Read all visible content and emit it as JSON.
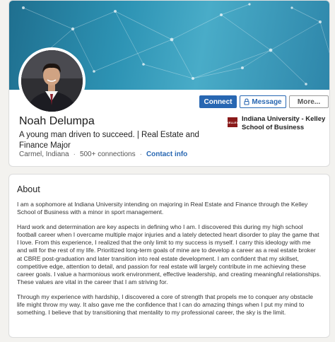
{
  "profile": {
    "name": "Noah Delumpa",
    "headline": "A young man driven to succeed. | Real Estate and Finance Major",
    "location": "Carmel, Indiana",
    "connections": "500+ connections",
    "contact_info": "Contact info",
    "education": {
      "logo_text": "KELLEY",
      "name": "Indiana University - Kelley School of Business"
    },
    "actions": {
      "connect": "Connect",
      "message": "Message",
      "more": "More..."
    }
  },
  "about": {
    "title": "About",
    "paragraphs": [
      "I am a sophomore at Indiana University intending on majoring in Real Estate and Finance through the Kelley School of Business with a minor in sport management.",
      "Hard work and determination are key aspects in defining who I am. I discovered this during my high school football career when I overcame multiple major injuries and a lately detected heart disorder to play the game that I love. From this experience, I realized that the only limit to my success is myself. I carry this ideology with me and will for the rest of my life. Prioritized long-term goals of mine are to develop a career as a real estate broker at CBRE post-graduation and later transition into real estate development. I am confident that my skillset, competitive edge, attention to detail, and passion for real estate will largely contribute in me achieving these career goals. I value a harmonious work environment, effective leadership, and creating meaningful relationships. These values are vital in the career that I am striving for.",
      "Through my experience with hardship, I discovered a core of strength that propels me to conquer any obstacle life might throw my way. It also gave me the confidence that I can do amazing things when I put my mind to something. I believe that by transitioning that mentality to my professional career, the sky is the limit."
    ]
  },
  "icons": {
    "message_button": "lock-icon",
    "education": "kelley-school-logo"
  },
  "colors": {
    "primary": "#2867b2",
    "page_background": "#f3f2ef",
    "banner": "#2d93b4"
  }
}
